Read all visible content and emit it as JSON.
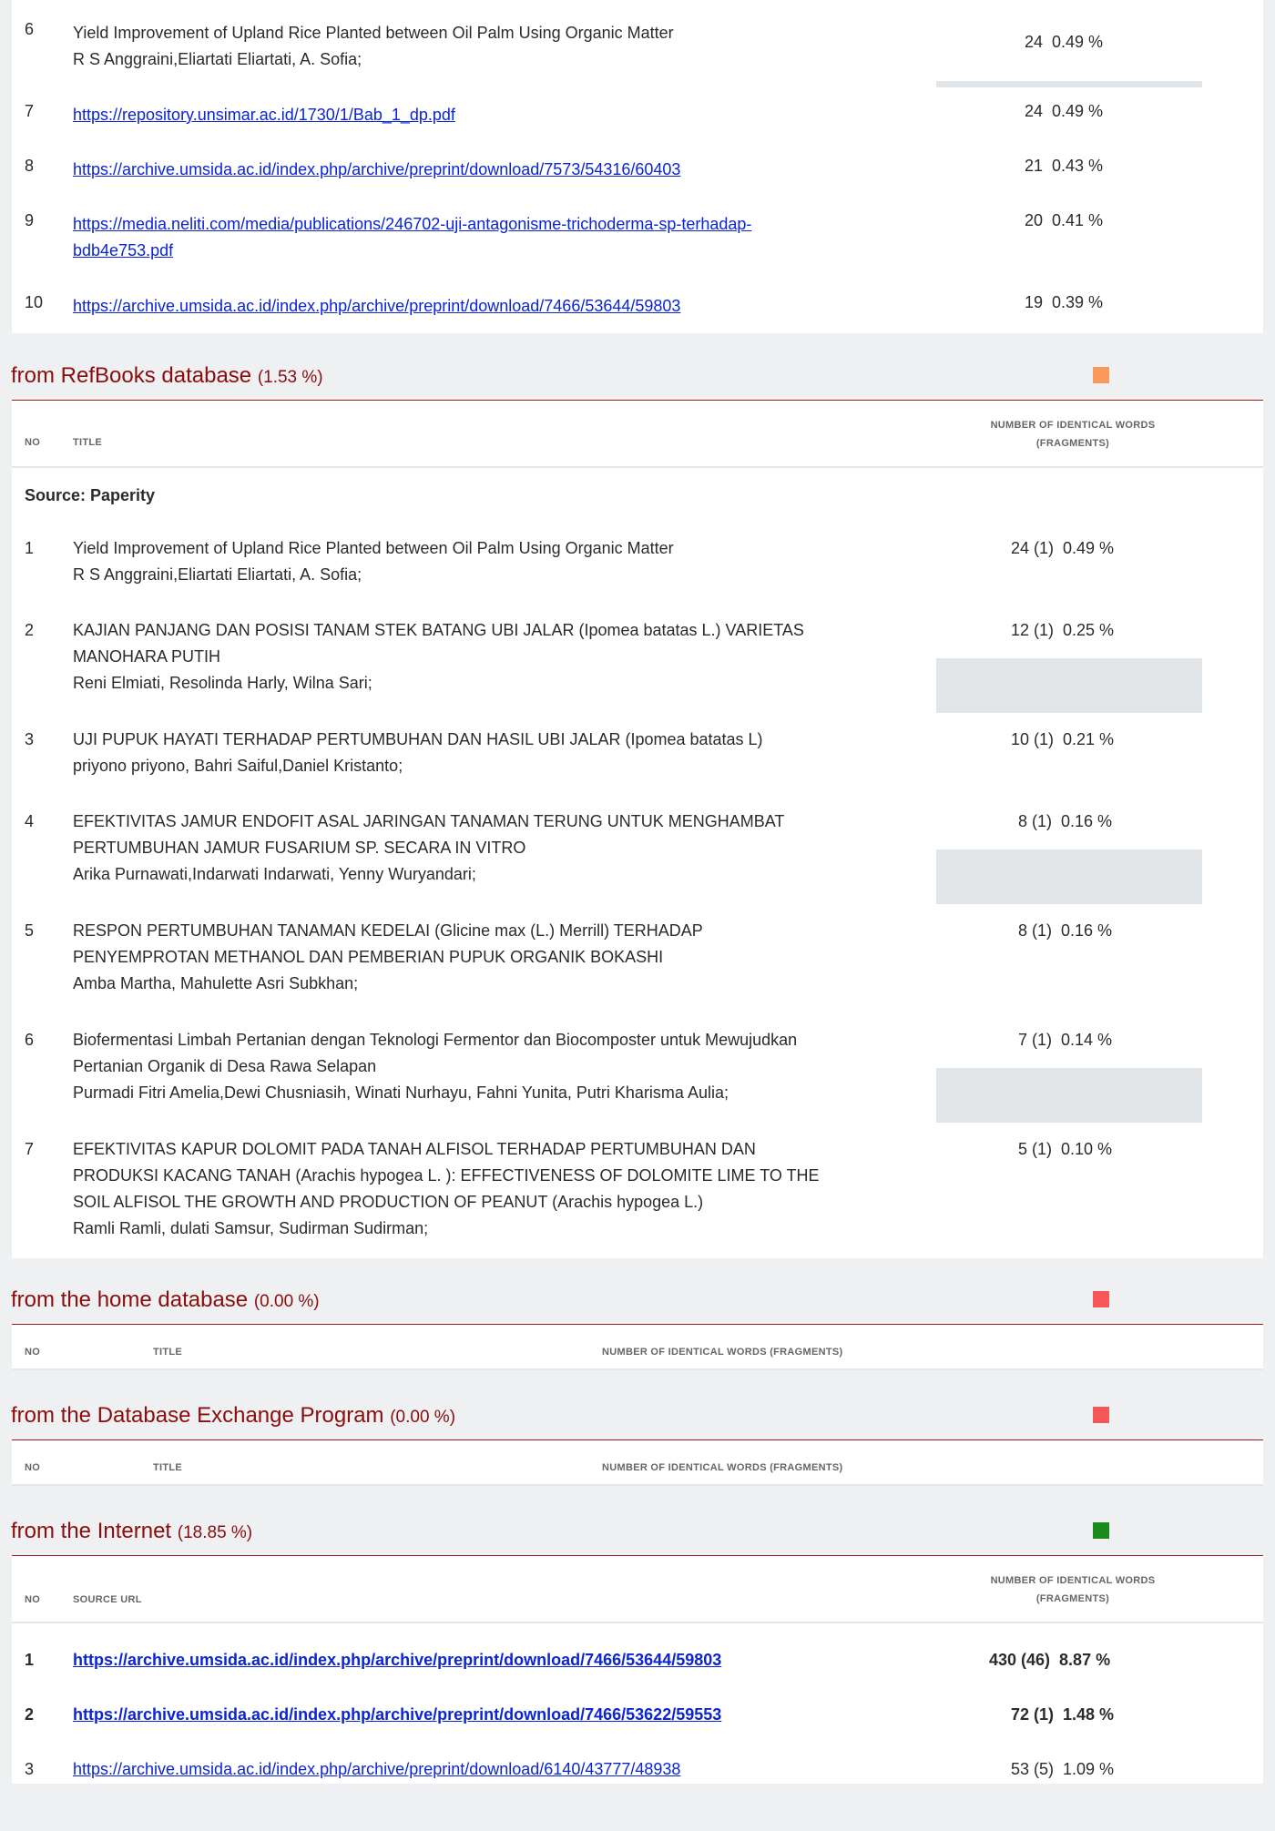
{
  "top_table": {
    "rows": [
      {
        "no": "6",
        "title": "Yield Improvement of Upland Rice Planted between Oil Palm Using Organic Matter",
        "authors": "R S Anggraini,Eliartati Eliartati, A. Sofia;",
        "stat": "24  0.49 %"
      },
      {
        "no": "7",
        "url": "https://repository.unsimar.ac.id/1730/1/Bab_1_dp.pdf",
        "stat": "24  0.49 %"
      },
      {
        "no": "8",
        "url": "https://archive.umsida.ac.id/index.php/archive/preprint/download/7573/54316/60403",
        "stat": "21  0.43 %"
      },
      {
        "no": "9",
        "url_line1": "https://media.neliti.com/media/publications/246702-uji-antagonisme-trichoderma-sp-terhadap-",
        "url_line2": "bdb4e753.pdf",
        "stat": "20  0.41 %"
      },
      {
        "no": "10",
        "url": "https://archive.umsida.ac.id/index.php/archive/preprint/download/7466/53644/59803",
        "stat": "19  0.39 %"
      }
    ]
  },
  "refbooks": {
    "title": "from RefBooks database",
    "pct": "(1.53 %)",
    "color": "#f99a5c",
    "col_no": "NO",
    "col_title": "TITLE",
    "col_words_1": "NUMBER OF IDENTICAL WORDS",
    "col_words_2": "(FRAGMENTS)",
    "source_label": "Source: Paperity",
    "rows": [
      {
        "no": "1",
        "lines": [
          "Yield Improvement of Upland Rice Planted between Oil Palm Using Organic Matter"
        ],
        "authors": "R S Anggraini,Eliartati Eliartati, A. Sofia;",
        "stat": "24 (1)  0.49 %"
      },
      {
        "no": "2",
        "lines": [
          "KAJIAN PANJANG DAN POSISI TANAM STEK BATANG UBI JALAR (Ipomea batatas L.) VARIETAS",
          "MANOHARA PUTIH"
        ],
        "authors": "Reni Elmiati, Resolinda Harly, Wilna Sari;",
        "stat": "12 (1)  0.25 %"
      },
      {
        "no": "3",
        "lines": [
          "UJI PUPUK HAYATI TERHADAP PERTUMBUHAN DAN HASIL UBI JALAR (Ipomea batatas L)"
        ],
        "authors": "priyono priyono, Bahri Saiful,Daniel Kristanto;",
        "stat": "10 (1)  0.21 %"
      },
      {
        "no": "4",
        "lines": [
          "EFEKTIVITAS JAMUR ENDOFIT ASAL JARINGAN TANAMAN TERUNG UNTUK MENGHAMBAT",
          "PERTUMBUHAN JAMUR FUSARIUM SP. SECARA IN VITRO"
        ],
        "authors": "Arika Purnawati,Indarwati Indarwati, Yenny Wuryandari;",
        "stat": "8 (1)  0.16 %"
      },
      {
        "no": "5",
        "lines": [
          "RESPON PERTUMBUHAN TANAMAN KEDELAI (Glicine max (L.) Merrill) TERHADAP",
          "PENYEMPROTAN METHANOL DAN PEMBERIAN PUPUK ORGANIK BOKASHI"
        ],
        "authors": "Amba Martha, Mahulette Asri Subkhan;",
        "stat": "8 (1)  0.16 %"
      },
      {
        "no": "6",
        "lines": [
          "Biofermentasi Limbah Pertanian dengan Teknologi Fermentor dan Biocomposter untuk Mewujudkan",
          "Pertanian Organik di Desa Rawa Selapan"
        ],
        "authors": "Purmadi Fitri Amelia,Dewi Chusniasih, Winati Nurhayu, Fahni Yunita, Putri Kharisma Aulia;",
        "stat": "7 (1)  0.14 %"
      },
      {
        "no": "7",
        "lines": [
          "EFEKTIVITAS KAPUR DOLOMIT PADA TANAH ALFISOL TERHADAP PERTUMBUHAN DAN",
          "PRODUKSI KACANG TANAH (Arachis hypogea L. ): EFFECTIVENESS OF DOLOMITE LIME TO THE",
          "SOIL ALFISOL THE GROWTH AND PRODUCTION OF PEANUT (Arachis hypogea L.)"
        ],
        "authors": "Ramli Ramli, dulati Samsur, Sudirman Sudirman;",
        "stat": "5 (1)  0.10 %"
      }
    ]
  },
  "home": {
    "title": "from the home database",
    "pct": "(0.00 %)",
    "color": "#f55757",
    "col_no": "NO",
    "col_title": "TITLE",
    "col_words": "NUMBER OF IDENTICAL WORDS (FRAGMENTS)"
  },
  "exchange": {
    "title": "from the Database Exchange Program",
    "pct": "(0.00 %)",
    "color": "#f55757",
    "col_no": "NO",
    "col_title": "TITLE",
    "col_words": "NUMBER OF IDENTICAL WORDS (FRAGMENTS)"
  },
  "internet": {
    "title": "from the Internet",
    "pct": "(18.85 %)",
    "color": "#1a8a1a",
    "col_no": "NO",
    "col_source": "SOURCE URL",
    "col_words_1": "NUMBER OF IDENTICAL WORDS",
    "col_words_2": "(FRAGMENTS)",
    "rows": [
      {
        "no": "1",
        "url": "https://archive.umsida.ac.id/index.php/archive/preprint/download/7466/53644/59803",
        "stat": "430 (46)  8.87 %",
        "bold": true
      },
      {
        "no": "2",
        "url": "https://archive.umsida.ac.id/index.php/archive/preprint/download/7466/53622/59553",
        "stat": "72 (1)  1.48 %",
        "bold": true
      },
      {
        "no": "3",
        "url": "https://archive.umsida.ac.id/index.php/archive/preprint/download/6140/43777/48938",
        "stat": "53 (5)  1.09 %",
        "bold": false
      }
    ]
  }
}
